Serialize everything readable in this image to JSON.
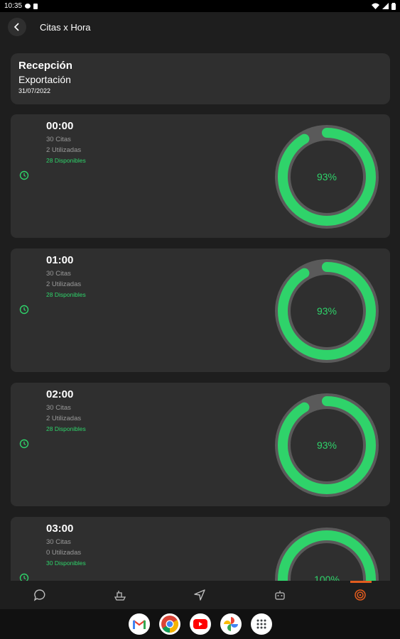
{
  "status_bar": {
    "time": "10:35"
  },
  "app_bar": {
    "title": "Citas x Hora"
  },
  "header": {
    "type": "Recepción",
    "operation": "Exportación",
    "date": "31/07/2022"
  },
  "slots": [
    {
      "time": "00:00",
      "citas": "30 Citas",
      "utilizadas": "2 Utilizadas",
      "disponibles": "28 Disponibles",
      "percent_label": "93%",
      "percent": 93
    },
    {
      "time": "01:00",
      "citas": "30 Citas",
      "utilizadas": "2 Utilizadas",
      "disponibles": "28 Disponibles",
      "percent_label": "93%",
      "percent": 93
    },
    {
      "time": "02:00",
      "citas": "30 Citas",
      "utilizadas": "2 Utilizadas",
      "disponibles": "28 Disponibles",
      "percent_label": "93%",
      "percent": 93
    },
    {
      "time": "03:00",
      "citas": "30 Citas",
      "utilizadas": "0 Utilizadas",
      "disponibles": "30 Disponibles",
      "percent_label": "100%",
      "percent": 100
    }
  ],
  "bottom_nav": {
    "items": [
      {
        "icon": "chat-icon"
      },
      {
        "icon": "ship-icon"
      },
      {
        "icon": "navigation-icon"
      },
      {
        "icon": "robot-icon"
      },
      {
        "icon": "radar-icon",
        "active": true
      }
    ]
  },
  "dock": {
    "apps": [
      "gmail-icon",
      "chrome-icon",
      "youtube-icon",
      "photos-icon",
      "app-drawer-icon"
    ]
  },
  "colors": {
    "accent_green": "#2fd36a",
    "ring_track": "#5a5a5a",
    "card": "#2f2f2f",
    "background": "#1e1e1e",
    "active_nav": "#e25c1e"
  }
}
